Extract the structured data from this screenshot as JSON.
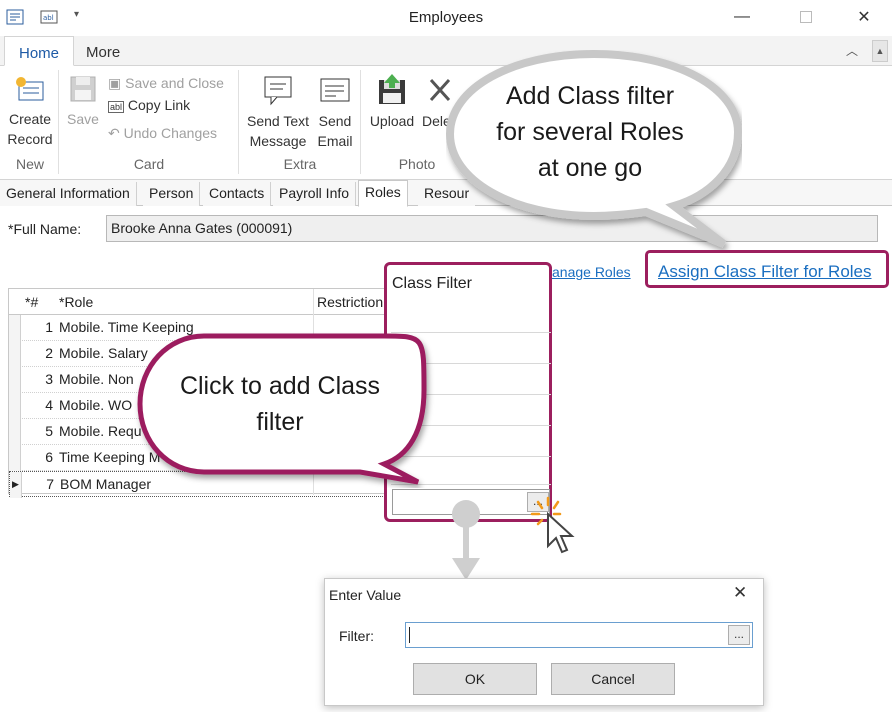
{
  "window": {
    "title": "Employees"
  },
  "ribbon": {
    "tabs": [
      "Home",
      "More"
    ],
    "buttons": {
      "create_record": "Create\nRecord",
      "save": "Save",
      "save_and_close": "Save and Close",
      "copy_link": "Copy Link",
      "undo_changes": "Undo Changes",
      "send_text_message": "Send Text\nMessage",
      "send_email": "Send\nEmail",
      "upload": "Upload",
      "delete": "Dele"
    },
    "groups": {
      "new": "New",
      "card": "Card",
      "extra": "Extra",
      "photo": "Photo"
    }
  },
  "form_tabs": [
    "General Information",
    "Person",
    "Contacts",
    "Payroll Info",
    "Roles",
    "Resour"
  ],
  "form": {
    "full_name_label": "*Full Name:",
    "full_name_value": "Brooke Anna Gates (000091)"
  },
  "links": {
    "manage_roles": "anage Roles",
    "assign_class_filter": "Assign Class Filter for Roles"
  },
  "grid": {
    "headers": {
      "num": "*#",
      "role": "*Role",
      "restriction": "Restriction"
    },
    "rows": [
      {
        "num": "1",
        "role": "Mobile. Time Keeping"
      },
      {
        "num": "2",
        "role": "Mobile. Salary"
      },
      {
        "num": "3",
        "role": "Mobile. Non"
      },
      {
        "num": "4",
        "role": "Mobile. WO"
      },
      {
        "num": "5",
        "role": "Mobile. Requ"
      },
      {
        "num": "6",
        "role": "Time Keeping M"
      },
      {
        "num": "7",
        "role": "BOM Manager"
      }
    ]
  },
  "class_filter": {
    "header": "Class Filter",
    "ellipsis": "..."
  },
  "callouts": {
    "top": "Add Class filter\nfor several Roles\nat one go",
    "middle": "Click to add Class\nfilter"
  },
  "dialog": {
    "title": "Enter Value",
    "filter_label": "Filter:",
    "ok": "OK",
    "cancel": "Cancel",
    "ellipsis": "..."
  },
  "colors": {
    "accent": "#9c1f5e",
    "link": "#1a6ec0"
  }
}
